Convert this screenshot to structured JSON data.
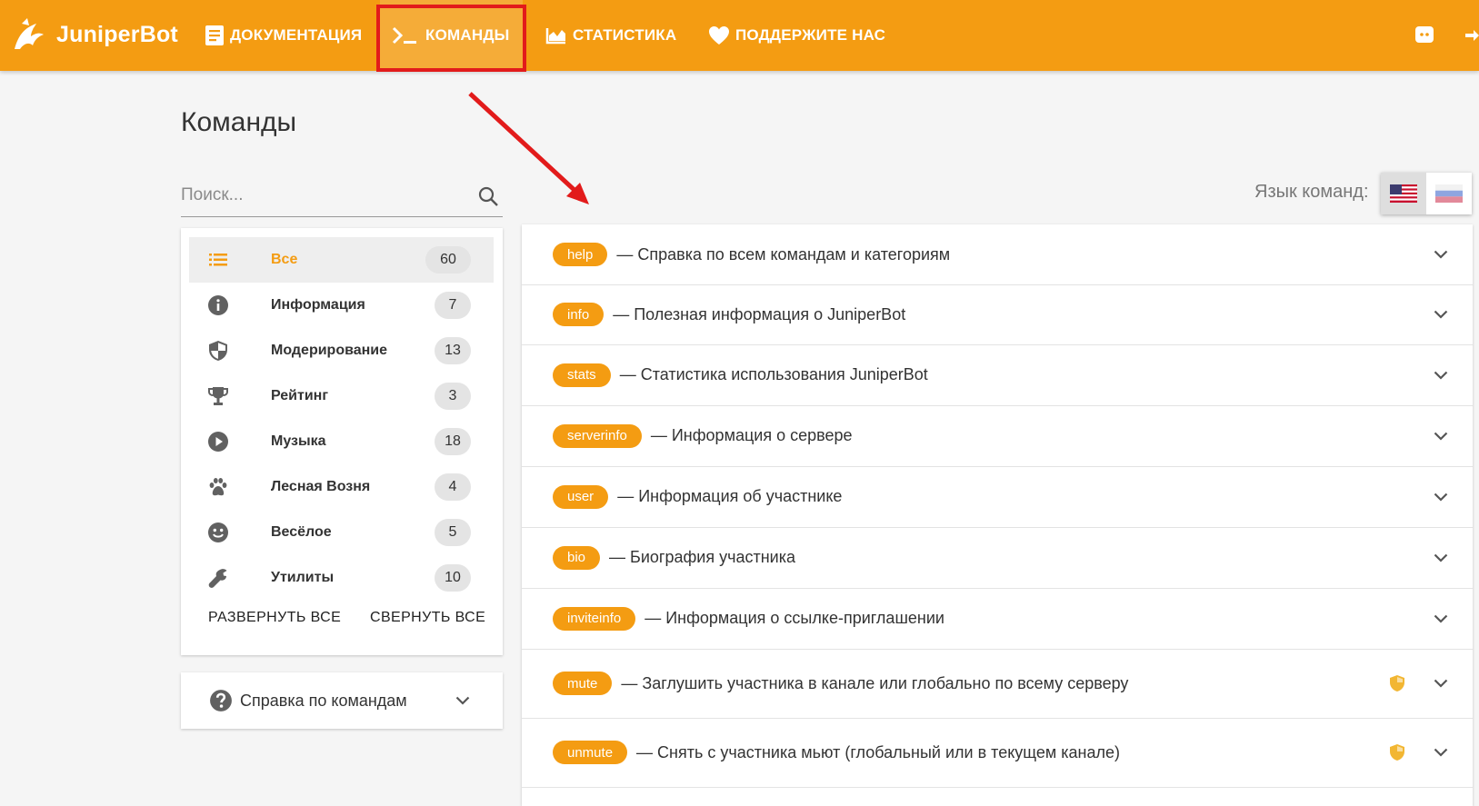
{
  "brand": {
    "name": "JuniperBot"
  },
  "nav": [
    {
      "label": "ДОКУМЕНТАЦИЯ",
      "icon": "book-icon"
    },
    {
      "label": "КОМАНДЫ",
      "icon": "terminal-icon"
    },
    {
      "label": "СТАТИСТИКА",
      "icon": "chart-icon"
    },
    {
      "label": "ПОДДЕРЖИТЕ НАС",
      "icon": "heart-icon"
    }
  ],
  "header_right": {
    "discord_icon": "discord-icon",
    "login_icon": "login-icon"
  },
  "page": {
    "title": "Команды"
  },
  "search": {
    "placeholder": "Поиск...",
    "value": ""
  },
  "categories": [
    {
      "label": "Все",
      "count": "60",
      "icon": "list-icon",
      "active": true
    },
    {
      "label": "Информация",
      "count": "7",
      "icon": "info-icon"
    },
    {
      "label": "Модерирование",
      "count": "13",
      "icon": "shield-icon"
    },
    {
      "label": "Рейтинг",
      "count": "3",
      "icon": "trophy-icon"
    },
    {
      "label": "Музыка",
      "count": "18",
      "icon": "play-icon"
    },
    {
      "label": "Лесная Возня",
      "count": "4",
      "icon": "paw-icon"
    },
    {
      "label": "Весёлое",
      "count": "5",
      "icon": "smile-icon"
    },
    {
      "label": "Утилиты",
      "count": "10",
      "icon": "wrench-icon"
    }
  ],
  "card_actions": {
    "expand_all": "РАЗВЕРНУТЬ ВСЕ",
    "collapse_all": "СВЕРНУТЬ ВСЕ"
  },
  "help_panel": {
    "label": "Справка по командам"
  },
  "language": {
    "label": "Язык команд:",
    "options": [
      "en",
      "ru"
    ],
    "selected": "en"
  },
  "commands": [
    {
      "name": "help",
      "desc": "— Справка по всем командам и категориям",
      "moderator_only": false
    },
    {
      "name": "info",
      "desc": "— Полезная информация о JuniperBot",
      "moderator_only": false
    },
    {
      "name": "stats",
      "desc": "— Статистика использования JuniperBot",
      "moderator_only": false
    },
    {
      "name": "serverinfo",
      "desc": "— Информация о сервере",
      "moderator_only": false
    },
    {
      "name": "user",
      "desc": "— Информация об участнике",
      "moderator_only": false
    },
    {
      "name": "bio",
      "desc": "— Биография участника",
      "moderator_only": false
    },
    {
      "name": "inviteinfo",
      "desc": "— Информация о ссылке-приглашении",
      "moderator_only": false
    },
    {
      "name": "mute",
      "desc": "— Заглушить участника в канале или глобально по всему серверу",
      "moderator_only": true
    },
    {
      "name": "unmute",
      "desc": "— Снять с участника мьют (глобальный или в текущем канале)",
      "moderator_only": true
    }
  ],
  "colors": {
    "accent": "#f49c12",
    "annotation": "#e21b1b",
    "shield": "#f2b632"
  }
}
